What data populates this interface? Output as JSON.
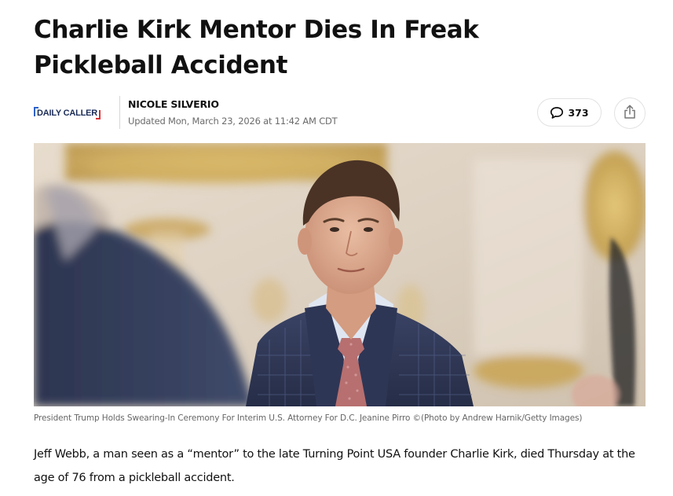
{
  "article": {
    "headline": "Charlie Kirk Mentor Dies In Freak Pickleball Accident",
    "publisher_logo": "DAILY CALLER",
    "author": "NICOLE SILVERIO",
    "updated": "Updated Mon, March 23, 2026 at 11:42 AM CDT",
    "comment_count": "373",
    "comment_icon": "speech-bubble-icon",
    "share_icon": "share-icon",
    "photo_caption": "President Trump Holds Swearing-In Ceremony For Interim U.S. Attorney For D.C. Jeanine Pirro ©(Photo by Andrew Harnik/Getty Images)",
    "body_paragraph": "Jeff Webb, a man seen as a “mentor” to the late Turning Point USA founder Charlie Kirk, died Thursday at the age of 76 from a pickleball accident."
  },
  "colors": {
    "logo_blue": "#2d62c8",
    "logo_red": "#d62e34",
    "logo_text": "#1a2b57",
    "meta_gray": "#6b6b6b"
  }
}
